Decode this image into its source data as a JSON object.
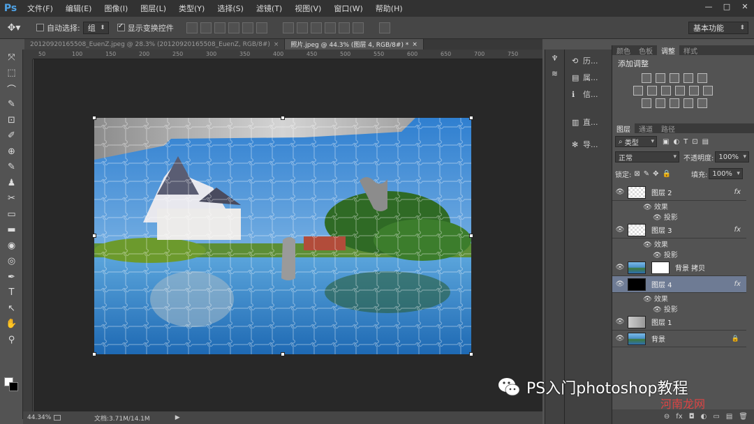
{
  "app": {
    "logo": "Ps"
  },
  "menu": [
    "文件(F)",
    "编辑(E)",
    "图像(I)",
    "图层(L)",
    "类型(Y)",
    "选择(S)",
    "滤镜(T)",
    "视图(V)",
    "窗口(W)",
    "帮助(H)"
  ],
  "window_controls": [
    "—",
    "□",
    "✕"
  ],
  "options": {
    "auto_select_label": "自动选择:",
    "auto_select_value": "组",
    "show_transform_label": "显示变换控件",
    "workspace": "基本功能"
  },
  "tabs": [
    {
      "label": "20120920165508_EuenZ.jpeg @ 28.3% (20120920165508_EuenZ, RGB/8#)",
      "close": "×"
    },
    {
      "label": "照片.jpeg @ 44.3% (图层 4, RGB/8#) *",
      "close": "×"
    }
  ],
  "tools": [
    "⤧",
    "⬚",
    "⌒",
    "✎",
    "⊡",
    "✐",
    "⊕",
    "✎",
    "♟",
    "✂",
    "▭",
    "▬",
    "◉",
    "◎",
    "✒",
    "T",
    "↖",
    "✋",
    "⚲"
  ],
  "ruler_ticks_h": [
    "50",
    "100",
    "150",
    "200",
    "250",
    "300",
    "350",
    "400",
    "450",
    "500",
    "550",
    "600",
    "650",
    "700",
    "750"
  ],
  "status": {
    "zoom": "44.34%",
    "doc": "文档:3.71M/14.1M"
  },
  "history_panel": [
    {
      "icon": "⟲",
      "label": "历..."
    },
    {
      "icon": "▤",
      "label": "属..."
    },
    {
      "icon": "ℹ",
      "label": "信..."
    },
    {
      "icon": "▥",
      "label": "直..."
    },
    {
      "icon": "✻",
      "label": "导..."
    }
  ],
  "adjust_tabs": [
    "颜色",
    "色板",
    "调整",
    "样式"
  ],
  "adjust_title": "添加调整",
  "layer_tabs": [
    "图层",
    "通道",
    "路径"
  ],
  "layer_filter": "类型",
  "blend_mode": "正常",
  "opacity_label": "不透明度:",
  "opacity_value": "100%",
  "lock_label": "锁定:",
  "fill_label": "填充:",
  "fill_value": "100%",
  "layers": [
    {
      "name": "图层 2",
      "thumb": "trans",
      "fx": true,
      "effects": [
        "效果",
        "投影"
      ]
    },
    {
      "name": "图层 3",
      "thumb": "trans",
      "fx": true,
      "effects": [
        "效果",
        "投影"
      ]
    },
    {
      "name": "背景 拷贝",
      "thumb": "photo",
      "mask": true,
      "fx": false
    },
    {
      "name": "图层 4",
      "thumb": "black",
      "fx": true,
      "selected": true,
      "effects": [
        "效果",
        "投影"
      ]
    },
    {
      "name": "图层 1",
      "thumb": "gray",
      "fx": false
    },
    {
      "name": "背景",
      "thumb": "photo",
      "fx": false,
      "locked": true
    }
  ],
  "fx_badge": "fx",
  "panel_footer": [
    "⊖",
    "fx",
    "◘",
    "◐",
    "▭",
    "▤",
    "🗑"
  ],
  "watermark": {
    "text": "PS入门photoshop教程",
    "sub": "河南龙网"
  }
}
